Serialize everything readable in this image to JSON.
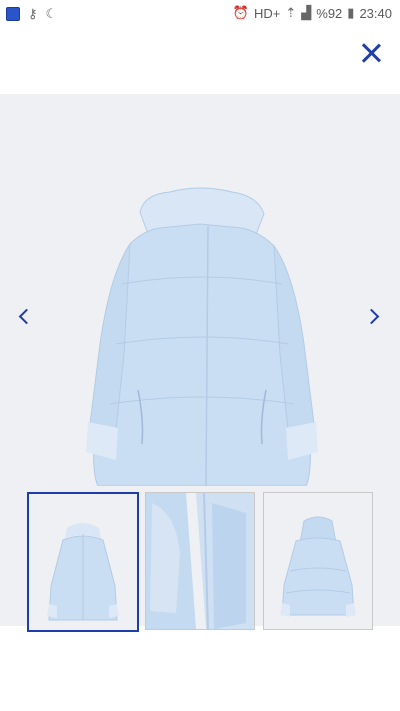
{
  "status_bar": {
    "network": "HD+",
    "battery": "%92",
    "time": "23:40"
  },
  "product": {
    "color": "#c9def2",
    "shade": "#b3cbe6",
    "fur": "#dde9f6"
  },
  "gallery": {
    "thumbnail_count": 3,
    "active_index": 0
  }
}
